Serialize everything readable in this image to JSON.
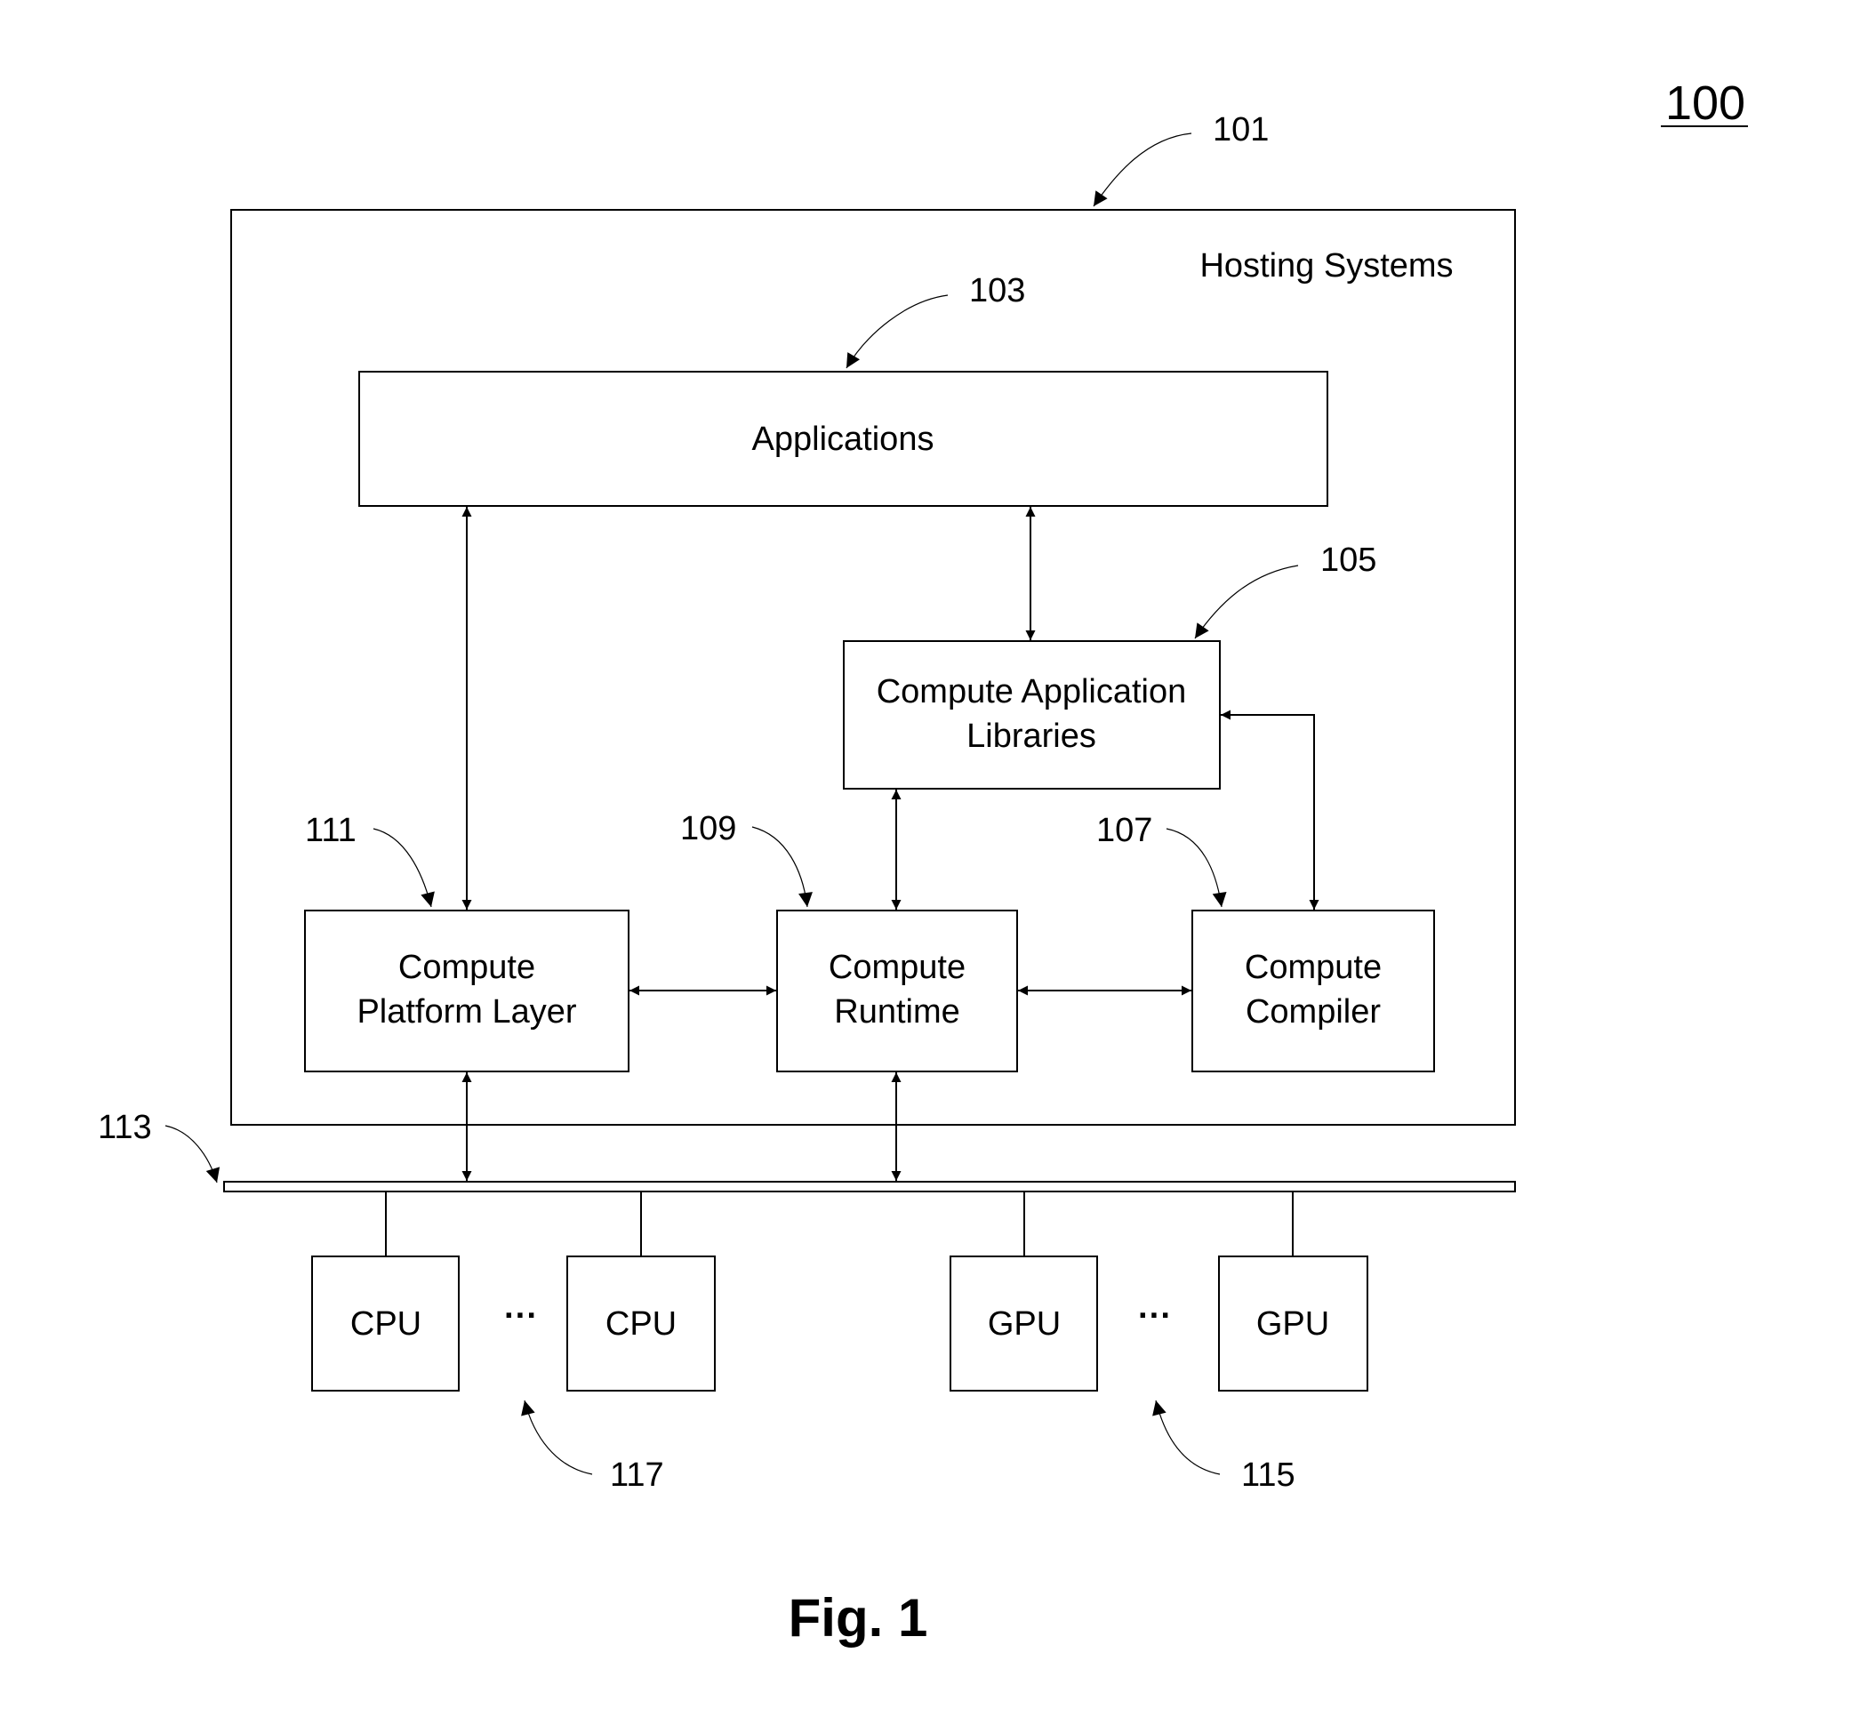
{
  "figure": {
    "number_label": "100",
    "caption": "Fig. 1"
  },
  "hosting_system": {
    "ref": "101",
    "label": "Hosting Systems"
  },
  "components": {
    "applications": {
      "ref": "103",
      "label": "Applications"
    },
    "compute_application_libraries": {
      "ref": "105",
      "label_line1": "Compute Application",
      "label_line2": "Libraries"
    },
    "compute_compiler": {
      "ref": "107",
      "label_line1": "Compute",
      "label_line2": "Compiler"
    },
    "compute_runtime": {
      "ref": "109",
      "label_line1": "Compute",
      "label_line2": "Runtime"
    },
    "compute_platform_layer": {
      "ref": "111",
      "label_line1": "Compute",
      "label_line2": "Platform Layer"
    }
  },
  "bus": {
    "ref": "113"
  },
  "gpus": {
    "ref": "115",
    "units": [
      "GPU",
      "GPU"
    ],
    "ellipsis": "···"
  },
  "cpus": {
    "ref": "117",
    "units": [
      "CPU",
      "CPU"
    ],
    "ellipsis": "···"
  }
}
